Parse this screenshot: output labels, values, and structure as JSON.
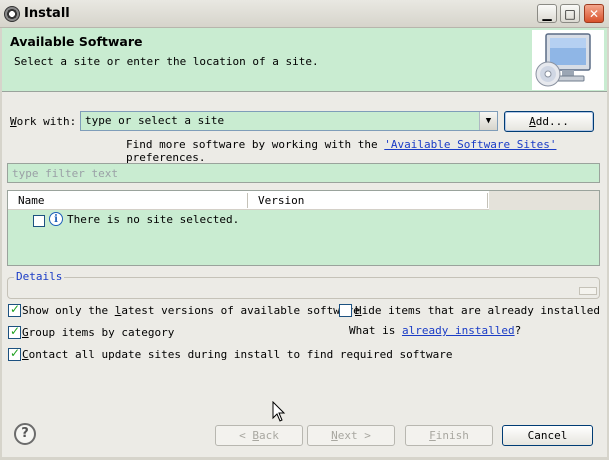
{
  "window": {
    "title": "Install",
    "min_glyph": "▁",
    "max_glyph": "□",
    "close_glyph": "✕"
  },
  "header": {
    "title": "Available Software",
    "description": "Select a site or enter the location of a site."
  },
  "work_with": {
    "label_mnemonic": "W",
    "label_rest": "ork with:",
    "value": "type or select a site",
    "add_mnemonic": "A",
    "add_rest": "dd..."
  },
  "find_more": {
    "prefix": "Find more software by working with the ",
    "link": "'Available Software Sites'",
    "suffix": " preferences."
  },
  "filter": {
    "placeholder": "type filter text"
  },
  "table": {
    "columns": [
      "Name",
      "Version"
    ],
    "message": "There is no site selected."
  },
  "details": {
    "label": "Details"
  },
  "options": {
    "show_latest": {
      "a": "Show only the ",
      "m": "l",
      "b": "atest versions of available software",
      "checked": true
    },
    "hide_installed": {
      "a": "",
      "m": "H",
      "b": "ide items that are already installed",
      "checked": false
    },
    "group_category": {
      "a": "",
      "m": "G",
      "b": "roup items by category",
      "checked": true
    },
    "what_is": {
      "prefix": "What is ",
      "link": "already installed",
      "suffix": "?"
    },
    "contact_sites": {
      "a": "",
      "m": "C",
      "b": "ontact all update sites during install to find required software",
      "checked": true
    }
  },
  "buttons": {
    "help_glyph": "?",
    "back": {
      "a": "< ",
      "m": "B",
      "b": "ack"
    },
    "next": {
      "a": "",
      "m": "N",
      "b": "ext >"
    },
    "finish": {
      "a": "",
      "m": "F",
      "b": "inish"
    },
    "cancel": "Cancel"
  },
  "colors": {
    "accent_green": "#c9ecd1",
    "link_blue": "#1a3cc6",
    "check_green": "#21a121"
  },
  "icons": {
    "app": "eclipse-icon",
    "banner": "monitor-cd-icon",
    "info": "info-icon",
    "help": "help-icon"
  }
}
